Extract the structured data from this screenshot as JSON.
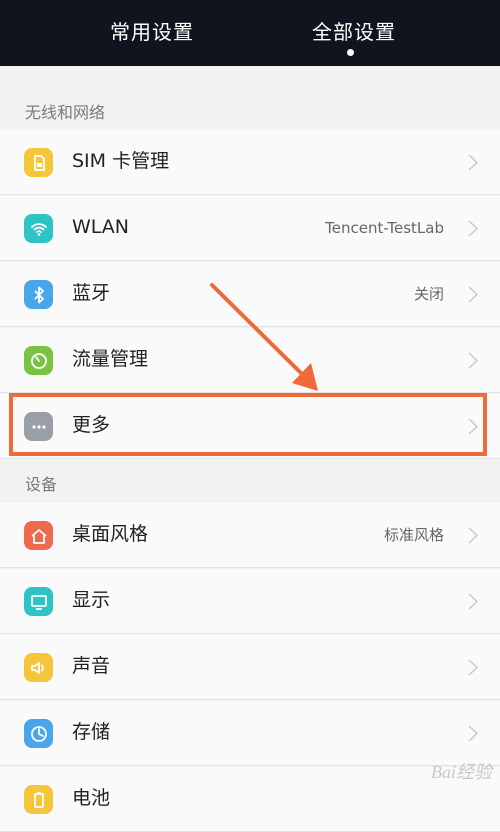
{
  "tabs": {
    "common": "常用设置",
    "all": "全部设置"
  },
  "sections": {
    "wireless": "无线和网络",
    "device": "设备"
  },
  "rows": {
    "sim": {
      "label": "SIM 卡管理",
      "value": ""
    },
    "wlan": {
      "label": "WLAN",
      "value": "Tencent-TestLab"
    },
    "bluetooth": {
      "label": "蓝牙",
      "value": "关闭"
    },
    "data": {
      "label": "流量管理",
      "value": ""
    },
    "more": {
      "label": "更多",
      "value": ""
    },
    "theme": {
      "label": "桌面风格",
      "value": "标准风格"
    },
    "display": {
      "label": "显示",
      "value": ""
    },
    "sound": {
      "label": "声音",
      "value": ""
    },
    "storage": {
      "label": "存储",
      "value": ""
    },
    "battery": {
      "label": "电池",
      "value": ""
    }
  },
  "icons": {
    "sim": "sim-card-icon",
    "wlan": "wifi-icon",
    "bluetooth": "bluetooth-icon",
    "data": "data-usage-icon",
    "more": "more-dots-icon",
    "theme": "home-icon",
    "display": "display-icon",
    "sound": "speaker-icon",
    "storage": "storage-clock-icon",
    "battery": "battery-icon"
  },
  "colors": {
    "highlight": "#ee6a3a",
    "topbar": "#11131f",
    "sim": "#f5c53a",
    "wlan": "#2ec3c4",
    "bluetooth": "#4aa6ea",
    "data": "#7cc242",
    "more": "#9a9ea6",
    "theme": "#ee6a4f",
    "display": "#2ec3c4",
    "sound": "#f5c53a",
    "storage": "#4aa6ea",
    "battery": "#f5c53a"
  },
  "watermark": "Bai经验"
}
